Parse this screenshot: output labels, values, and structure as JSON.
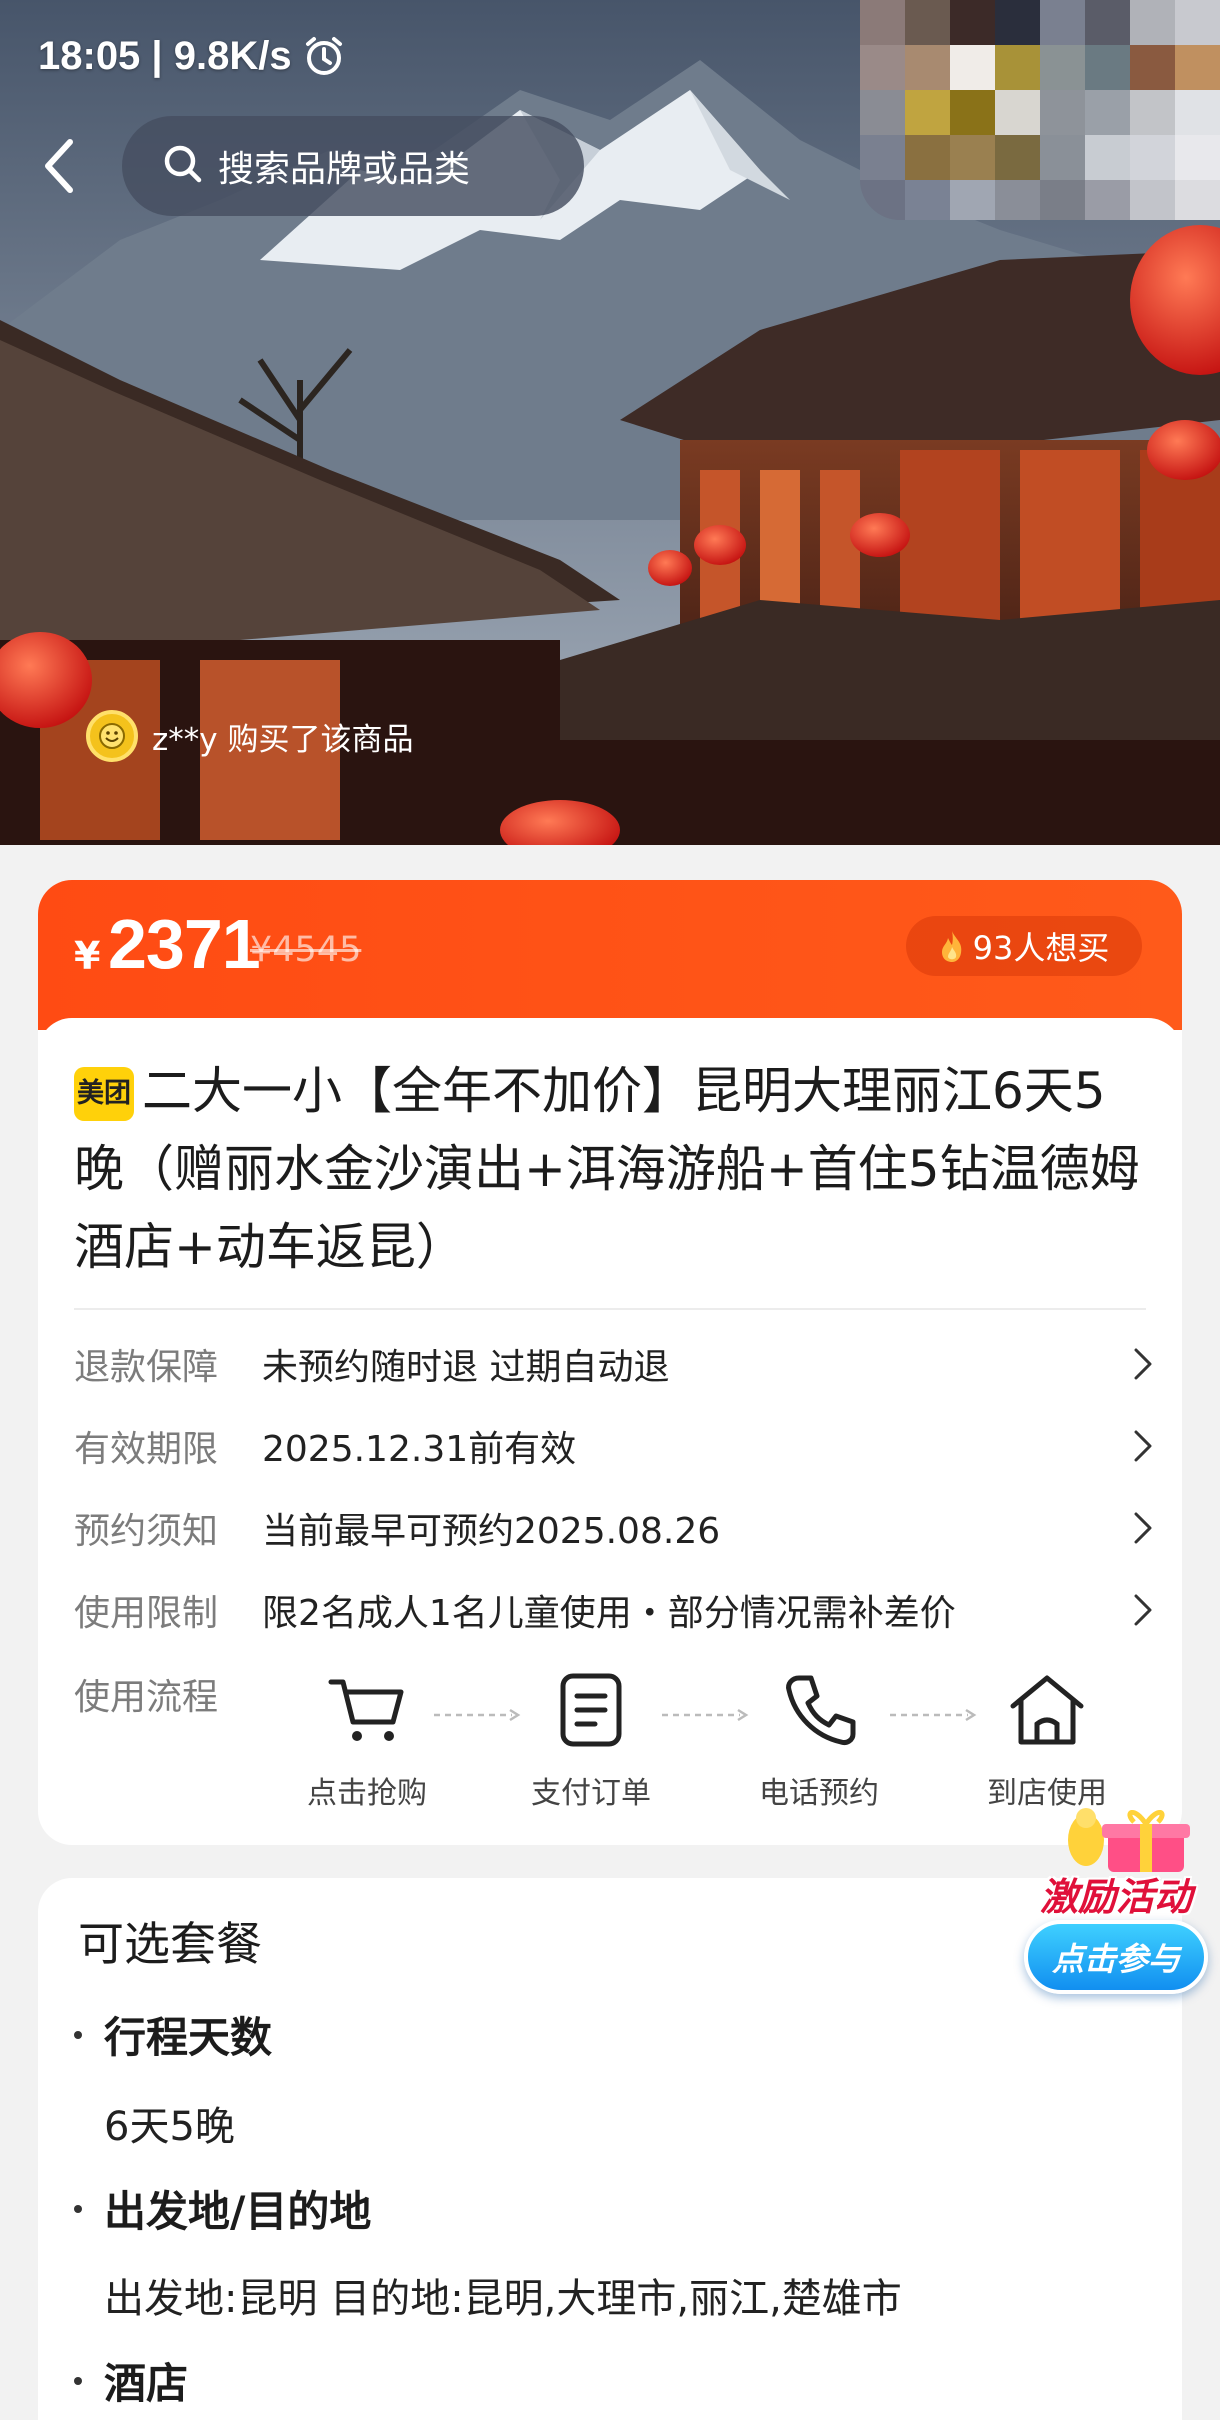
{
  "status_bar": {
    "time_speed": "18:05 | 9.8K/s"
  },
  "search": {
    "placeholder": "搜索品牌或品类"
  },
  "buyer_toast": {
    "text": "z**y 购买了该商品"
  },
  "price_band": {
    "currency": "¥",
    "price": "2371",
    "original_price": "¥4545",
    "want_count": "93人想买"
  },
  "product": {
    "brand_badge": "美团",
    "title": "二大一小【全年不加价】昆明大理丽江6天5晚（赠丽水金沙演出+洱海游船+首住5钻温德姆酒店+动车返昆）"
  },
  "info_rows": [
    {
      "label": "退款保障",
      "value": "未预约随时退 过期自动退"
    },
    {
      "label": "有效期限",
      "value": "2025.12.31前有效"
    },
    {
      "label": "预约须知",
      "value": "当前最早可预约2025.08.26"
    },
    {
      "label": "使用限制",
      "value": "限2名成人1名儿童使用・部分情况需补差价"
    }
  ],
  "usage_flow": {
    "label": "使用流程",
    "steps": [
      {
        "label": "点击抢购",
        "icon": "cart-icon"
      },
      {
        "label": "支付订单",
        "icon": "document-icon"
      },
      {
        "label": "电话预约",
        "icon": "phone-icon"
      },
      {
        "label": "到店使用",
        "icon": "home-icon"
      }
    ]
  },
  "options": {
    "title": "可选套餐",
    "sections": [
      {
        "heading": "行程天数",
        "value": "6天5晚"
      },
      {
        "heading": "出发地/目的地",
        "value": "出发地:昆明 目的地:昆明,大理市,丽江,楚雄市"
      },
      {
        "heading": "酒店",
        "value": ""
      }
    ]
  },
  "promo": {
    "title": "激励活动",
    "button": "点击参与"
  },
  "colors": {
    "accent": "#ff4b13",
    "badge_yellow": "#ffd10a",
    "promo_blue": "#118ff0"
  }
}
